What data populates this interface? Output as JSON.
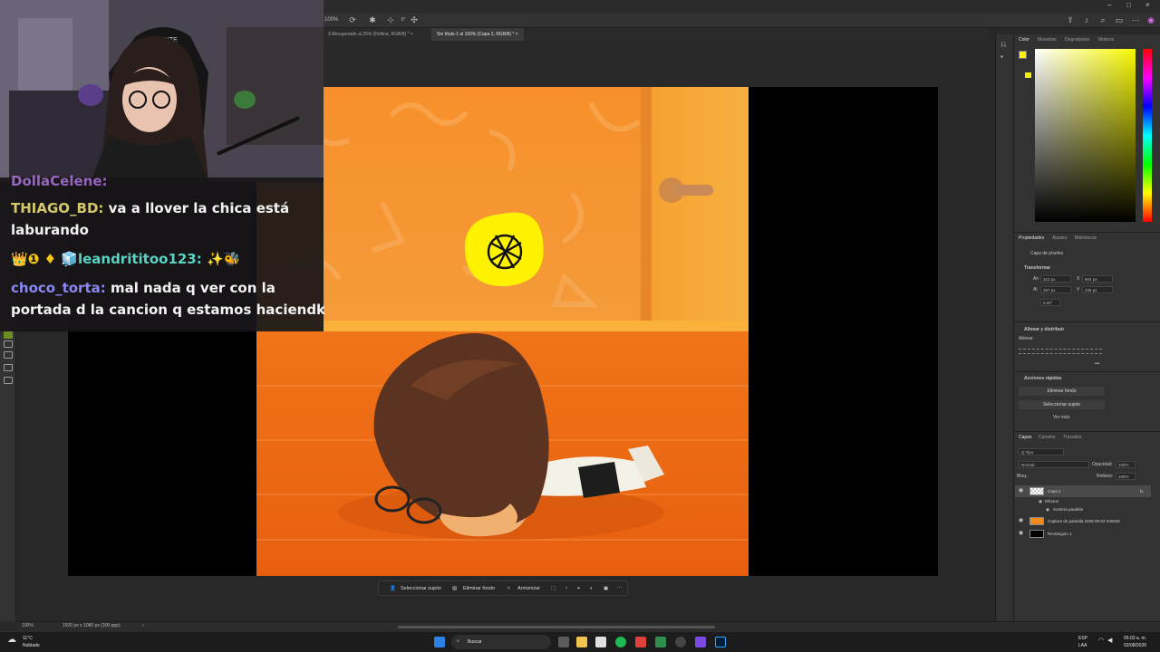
{
  "chat": {
    "partial_top": "DollaCelene:",
    "messages": [
      {
        "user": "THIAGO_BD:",
        "text": " va a llover la chica está",
        "text2": "laburando"
      },
      {
        "badges": "👑❶ ♦ 🧊",
        "user": "leandrititoo123:",
        "text": " ✨🐝"
      },
      {
        "user": "choco_torta:",
        "text": " mal nada q ver con la",
        "text2": "portada d la cancion q estamos haciendk"
      }
    ]
  },
  "tabs": [
    {
      "label": "3-Recuperado al 25% (Dellina, RGB/8) *  ×",
      "active": false
    },
    {
      "label": "Sin título-1 al 100% (Capa 2, RGB/8) *  ×",
      "active": true
    }
  ],
  "options": {
    "zoom": "100%",
    "angle": "0°"
  },
  "panels": {
    "color_tabs": [
      "Color",
      "Muestras",
      "Degradados",
      "Motivos"
    ],
    "props_tabs": [
      "Propiedades",
      "Ajustes",
      "Bibliotecas"
    ],
    "layer_kind": "Capa de píxeles",
    "transform_title": "Transformar",
    "transform": {
      "w_label": "An",
      "w": "312 px",
      "x_label": "X",
      "x": "604 px",
      "h_label": "Al",
      "h": "267 px",
      "y_label": "Y",
      "y": "236 px",
      "angle": "0,00°"
    },
    "align_title": "Alinear y distribuir",
    "align_label": "Alinear:",
    "quick_title": "Acciones rápidas",
    "btn_remove_bg": "Eliminar fondo",
    "btn_select_subject": "Seleccionar sujeto",
    "see_more": "Ver más",
    "layers_tabs": [
      "Capas",
      "Canales",
      "Trazados"
    ],
    "filter_kind": "Q Tipo",
    "blend_mode": "Normal",
    "opacity_label": "Opacidad:",
    "opacity": "100%",
    "lock_label": "Bloq.:",
    "fill_label": "Relleno:",
    "fill": "100%",
    "layers": [
      {
        "name": "Capa 2",
        "selected": true,
        "fx": "fx"
      },
      {
        "name": "Efectos",
        "sub": true
      },
      {
        "name": "Sombra paralela",
        "sub": true
      },
      {
        "name": "Captura de pantalla 2026-08-02 045528",
        "selected": false
      },
      {
        "name": "Rectángulo 1",
        "selected": false
      }
    ]
  },
  "context_bar": {
    "select_subject": "Seleccionar sujeto",
    "remove_bg": "Eliminar fondo",
    "harmonize": "Armonizar"
  },
  "status": {
    "zoom": "100%",
    "doc_info": "1920 px x 1080 px (300 ppp)"
  },
  "taskbar": {
    "weather_temp": "11°C",
    "weather_desc": "Nublado",
    "search": "Buscar",
    "lang": "ESP",
    "lang2": "LAA",
    "time": "05:03 a. m.",
    "date": "02/08/2026"
  },
  "colors": {
    "foreground": "#fff200",
    "background": "#f0f000",
    "accent_orange": "#f08a1c"
  }
}
